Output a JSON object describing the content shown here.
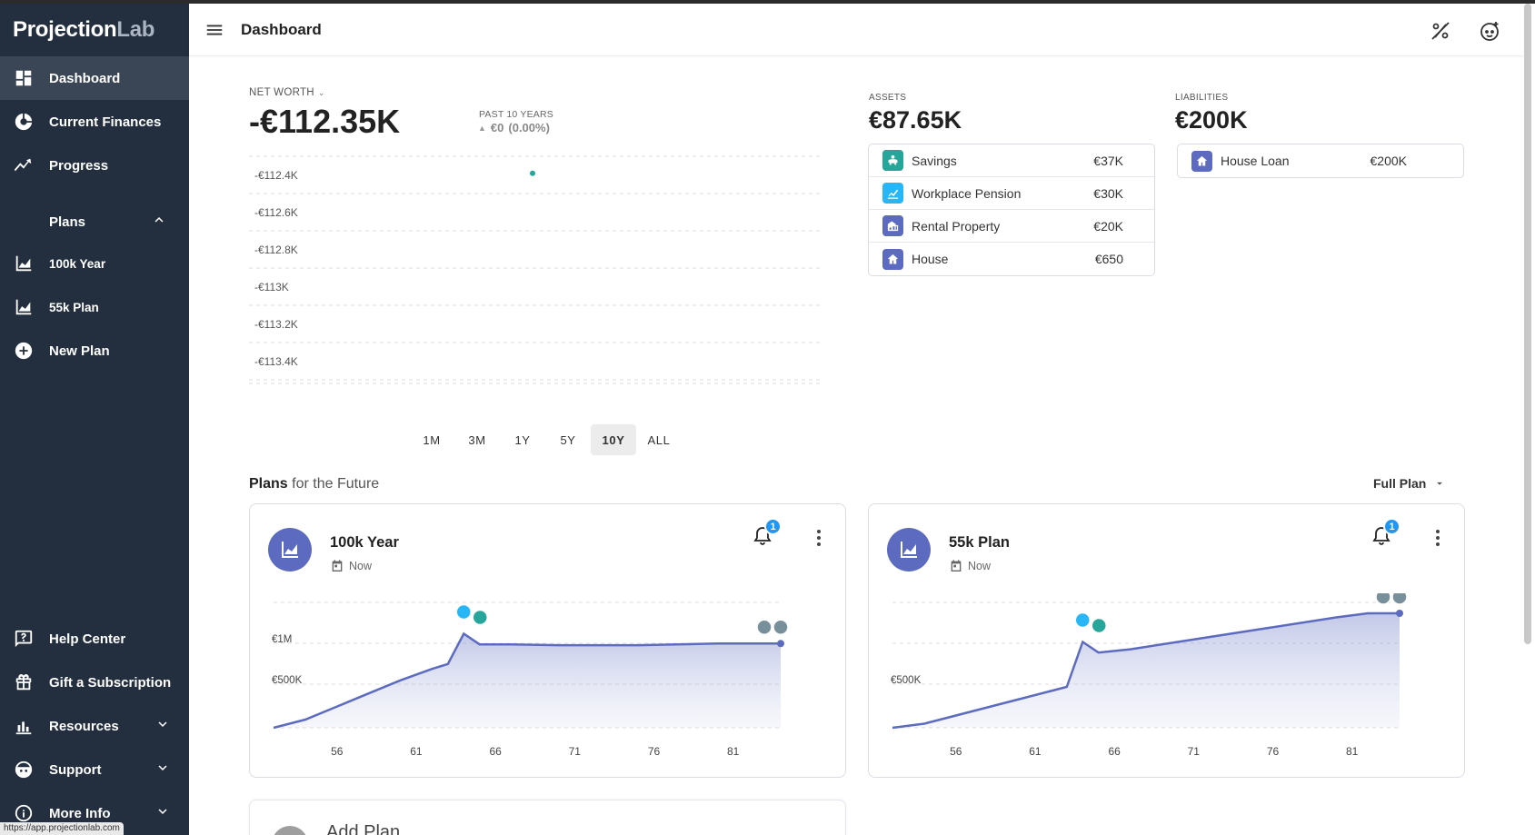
{
  "brand": {
    "part1": "Projection",
    "part2": "Lab"
  },
  "header": {
    "title": "Dashboard"
  },
  "sidebar": {
    "items": [
      {
        "label": "Dashboard"
      },
      {
        "label": "Current Finances"
      },
      {
        "label": "Progress"
      }
    ],
    "plans_label": "Plans",
    "plans": [
      {
        "label": "100k Year"
      },
      {
        "label": "55k Plan"
      }
    ],
    "new_plan": "New Plan",
    "bottom": [
      {
        "label": "Help Center"
      },
      {
        "label": "Gift a Subscription"
      },
      {
        "label": "Resources"
      },
      {
        "label": "Support"
      },
      {
        "label": "More Info"
      }
    ]
  },
  "status_url": "https://app.projectionlab.com",
  "net_worth": {
    "label": "NET WORTH",
    "value": "-€112.35K",
    "past_label": "PAST 10 YEARS",
    "change": "€0",
    "change_pct": "(0.00%)",
    "chart_data": {
      "type": "scatter",
      "y_ticks": [
        "-€112.4K",
        "-€112.6K",
        "-€112.8K",
        "-€113K",
        "-€113.2K",
        "-€113.4K"
      ],
      "points": [
        {
          "y": -112.35
        }
      ]
    },
    "ranges": [
      "1M",
      "3M",
      "1Y",
      "5Y",
      "10Y",
      "ALL"
    ],
    "active_range": "10Y"
  },
  "assets": {
    "label": "ASSETS",
    "value": "€87.65K",
    "items": [
      {
        "name": "Savings",
        "value": "€37K",
        "color": "#26a69a",
        "icon": "piggy-bank-icon"
      },
      {
        "name": "Workplace Pension",
        "value": "€30K",
        "color": "#29b6f6",
        "icon": "chart-up-icon"
      },
      {
        "name": "Rental Property",
        "value": "€20K",
        "color": "#5c6bc0",
        "icon": "building-icon"
      },
      {
        "name": "House",
        "value": "€650",
        "color": "#5c6bc0",
        "icon": "home-icon"
      }
    ]
  },
  "liabilities": {
    "label": "LIABILITIES",
    "value": "€200K",
    "items": [
      {
        "name": "House Loan",
        "value": "€200K",
        "color": "#5c6bc0",
        "icon": "home-icon"
      }
    ]
  },
  "plans": {
    "title_bold": "Plans",
    "title_rest": " for the Future",
    "view_label": "Full Plan",
    "cards": [
      {
        "name": "100k Year",
        "date": "Now",
        "badge": "1",
        "chart_data": {
          "type": "area",
          "x_ticks": [
            "56",
            "61",
            "66",
            "71",
            "76",
            "81"
          ],
          "y_ticks": [
            "€1M",
            "€500K"
          ],
          "x": [
            52,
            54,
            56,
            58,
            60,
            62,
            63,
            64,
            65,
            67,
            70,
            75,
            80,
            84
          ],
          "y": [
            0,
            100,
            260,
            420,
            580,
            720,
            780,
            1150,
            1020,
            1020,
            1010,
            1010,
            1030,
            1030
          ],
          "ylim": [
            0,
            1600
          ]
        }
      },
      {
        "name": "55k Plan",
        "date": "Now",
        "badge": "1",
        "chart_data": {
          "type": "area",
          "x_ticks": [
            "56",
            "61",
            "66",
            "71",
            "76",
            "81"
          ],
          "y_ticks": [
            "€500K"
          ],
          "x": [
            52,
            54,
            56,
            58,
            60,
            62,
            63,
            64,
            65,
            67,
            70,
            75,
            80,
            82,
            84
          ],
          "y": [
            0,
            50,
            150,
            250,
            350,
            450,
            500,
            1050,
            920,
            960,
            1050,
            1200,
            1350,
            1400,
            1400
          ],
          "ylim": [
            0,
            1600
          ]
        }
      }
    ],
    "add_plan": "Add Plan"
  }
}
